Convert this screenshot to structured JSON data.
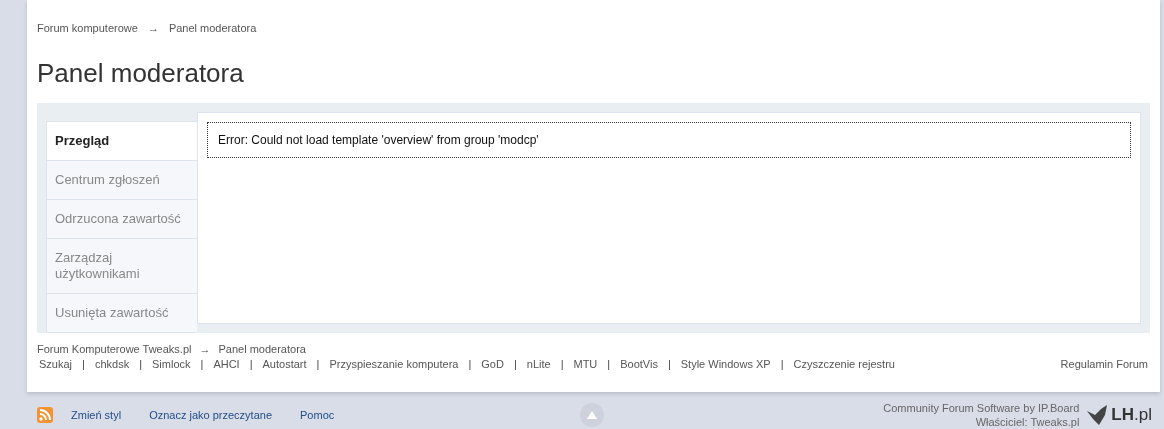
{
  "breadcrumb": {
    "items": [
      "Forum komputerowe",
      "Panel moderatora"
    ],
    "separator": "→"
  },
  "title": "Panel moderatora",
  "sidebar": {
    "items": [
      {
        "label": "Przegląd",
        "selected": true
      },
      {
        "label": "Centrum zgłoszeń",
        "selected": false
      },
      {
        "label": "Odrzucona zawartość",
        "selected": false
      },
      {
        "label": "Zarządzaj użytkownikami",
        "selected": false
      },
      {
        "label": "Usunięta zawartość",
        "selected": false
      }
    ]
  },
  "error_message": "Error: Could not load template 'overview' from group 'modcp'",
  "footer_breadcrumb": {
    "items": [
      "Forum Komputerowe Tweaks.pl",
      "Panel moderatora"
    ],
    "separator": "→"
  },
  "footer_links": {
    "separator": "|",
    "items": [
      "Szukaj",
      "chkdsk",
      "Simlock",
      "AHCI",
      "Autostart",
      "Przyspieszanie komputera",
      "GoD",
      "nLite",
      "MTU",
      "BootVis",
      "Style Windows XP",
      "Czyszczenie rejestru"
    ]
  },
  "rules_link": "Regulamin Forum",
  "bottom_links": [
    "Zmień styl",
    "Oznacz jako przeczytane",
    "Pomoc"
  ],
  "credits": [
    "Community Forum Software by IP.Board",
    "Właściciel: Tweaks.pl"
  ],
  "host_logo": {
    "main": "LH",
    "suffix": ".pl"
  }
}
